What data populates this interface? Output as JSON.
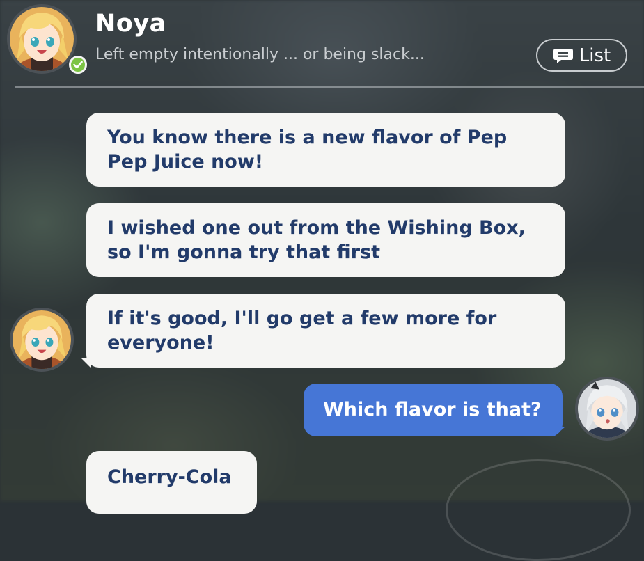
{
  "contact": {
    "name": "Noya",
    "status_text": "Left empty intentionally ... or being slack...",
    "online": true
  },
  "header": {
    "list_label": "List"
  },
  "messages": [
    {
      "sender": "contact",
      "text": "You know there is a new flavor of Pep Pep Juice now!"
    },
    {
      "sender": "contact",
      "text": "I wished one out from the Wishing Box, so I'm gonna try that first"
    },
    {
      "sender": "contact",
      "text": "If it's good, I'll go get a few more for everyone!"
    },
    {
      "sender": "me",
      "text": "Which flavor is that?"
    },
    {
      "sender": "contact",
      "text": "Cherry-Cola"
    }
  ],
  "colors": {
    "incoming_bubble": "#f5f5f3",
    "incoming_text": "#223b6a",
    "outgoing_bubble": "#4676d6",
    "online_badge": "#7cc444"
  },
  "icons": {
    "online": "check-icon",
    "list": "chat-bubble-icon"
  }
}
